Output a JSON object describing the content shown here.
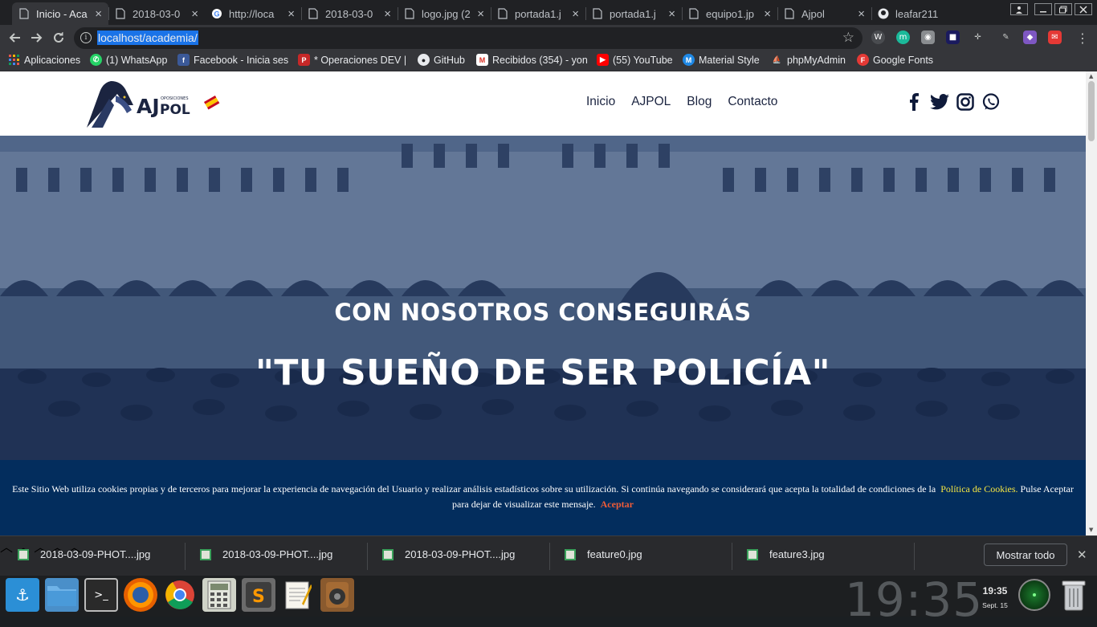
{
  "browser": {
    "tabs": [
      {
        "title": "Inicio - Aca",
        "icon": "page-icon",
        "active": true
      },
      {
        "title": "2018-03-0",
        "icon": "page-icon"
      },
      {
        "title": "http://loca",
        "icon": "google-icon"
      },
      {
        "title": "2018-03-0",
        "icon": "page-icon"
      },
      {
        "title": "logo.jpg (2",
        "icon": "page-icon"
      },
      {
        "title": "portada1.j",
        "icon": "page-icon"
      },
      {
        "title": "portada1.j",
        "icon": "page-icon"
      },
      {
        "title": "equipo1.jp",
        "icon": "page-icon"
      },
      {
        "title": "Ajpol",
        "icon": "page-icon"
      },
      {
        "title": "leafar211",
        "icon": "github-icon"
      }
    ],
    "tab_close": "×",
    "url": "localhost/academia/",
    "bookmarks": [
      {
        "label": "Aplicaciones",
        "icon": "apps-grid-icon"
      },
      {
        "label": "(1) WhatsApp",
        "icon": "whatsapp-icon"
      },
      {
        "label": "Facebook - Inicia ses",
        "icon": "facebook-icon"
      },
      {
        "label": "* Operaciones DEV |",
        "icon": "bookmark-red-icon"
      },
      {
        "label": "GitHub",
        "icon": "github-icon"
      },
      {
        "label": "Recibidos (354) - yon",
        "icon": "gmail-icon"
      },
      {
        "label": "(55) YouTube",
        "icon": "youtube-icon"
      },
      {
        "label": "Material Style",
        "icon": "material-icon"
      },
      {
        "label": "phpMyAdmin",
        "icon": "phpmyadmin-icon"
      },
      {
        "label": "Google Fonts",
        "icon": "google-fonts-icon"
      }
    ]
  },
  "site": {
    "logo_text": "AJPOL",
    "logo_small": "OPOSICIONES",
    "nav": [
      "Inicio",
      "AJPOL",
      "Blog",
      "Contacto"
    ],
    "social": [
      "facebook-icon",
      "twitter-icon",
      "instagram-icon",
      "whatsapp-icon"
    ],
    "hero": {
      "subtitle": "CON NOSOTROS CONSEGUIRÁS",
      "title": "\"TU SUEÑO DE SER POLICÍA\""
    },
    "cookie": {
      "text_before": "Este Sitio Web utiliza cookies propias y de terceros para mejorar la experiencia de navegación del Usuario y realizar análisis estadísticos sobre su utilización. Si continúa navegando se considerará que acepta la totalidad de condiciones de la",
      "link": "Política de Cookies.",
      "text_after": "Pulse Aceptar para dejar de visualizar este mensaje.",
      "accept": "Aceptar"
    }
  },
  "downloads": {
    "items": [
      "2018-03-09-PHOT....jpg",
      "2018-03-09-PHOT....jpg",
      "2018-03-09-PHOT....jpg",
      "feature0.jpg",
      "feature3.jpg"
    ],
    "show_all": "Mostrar todo"
  },
  "taskbar": {
    "big_clock": "19:35",
    "time": "19:35",
    "date": "Sept. 15",
    "apps": [
      "anchor-icon",
      "folder-icon",
      "terminal-icon",
      "firefox-icon",
      "chrome-icon",
      "calculator-icon",
      "sublime-icon",
      "text-editor-icon",
      "audio-icon"
    ]
  }
}
